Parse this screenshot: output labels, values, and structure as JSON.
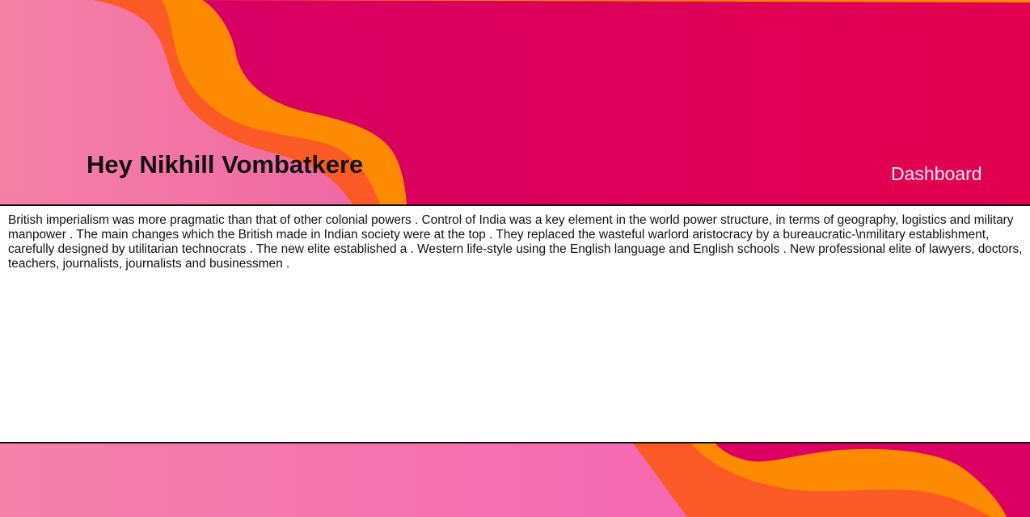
{
  "header": {
    "greeting": "Hey Nikhill Vombatkere",
    "nav_link": "Dashboard"
  },
  "main": {
    "article_text": "British imperialism was more pragmatic than that of other colonial powers . Control of India was a key element in the world power structure, in terms of geography, logistics and military manpower . The main changes which the British made in Indian society were at the top . They replaced the wasteful warlord aristocracy by a bureaucratic-\\nmilitary establishment, carefully designed by utilitarian technocrats . The new elite established a . Western life-style using the English language and English schools . New professional elite of lawyers, doctors, teachers, journalists, journalists and businessmen ."
  },
  "colors": {
    "magenta": "#dc0063",
    "pink": "#f57fa8",
    "orange": "#fd8a00",
    "orange_red": "#fb5a26"
  }
}
